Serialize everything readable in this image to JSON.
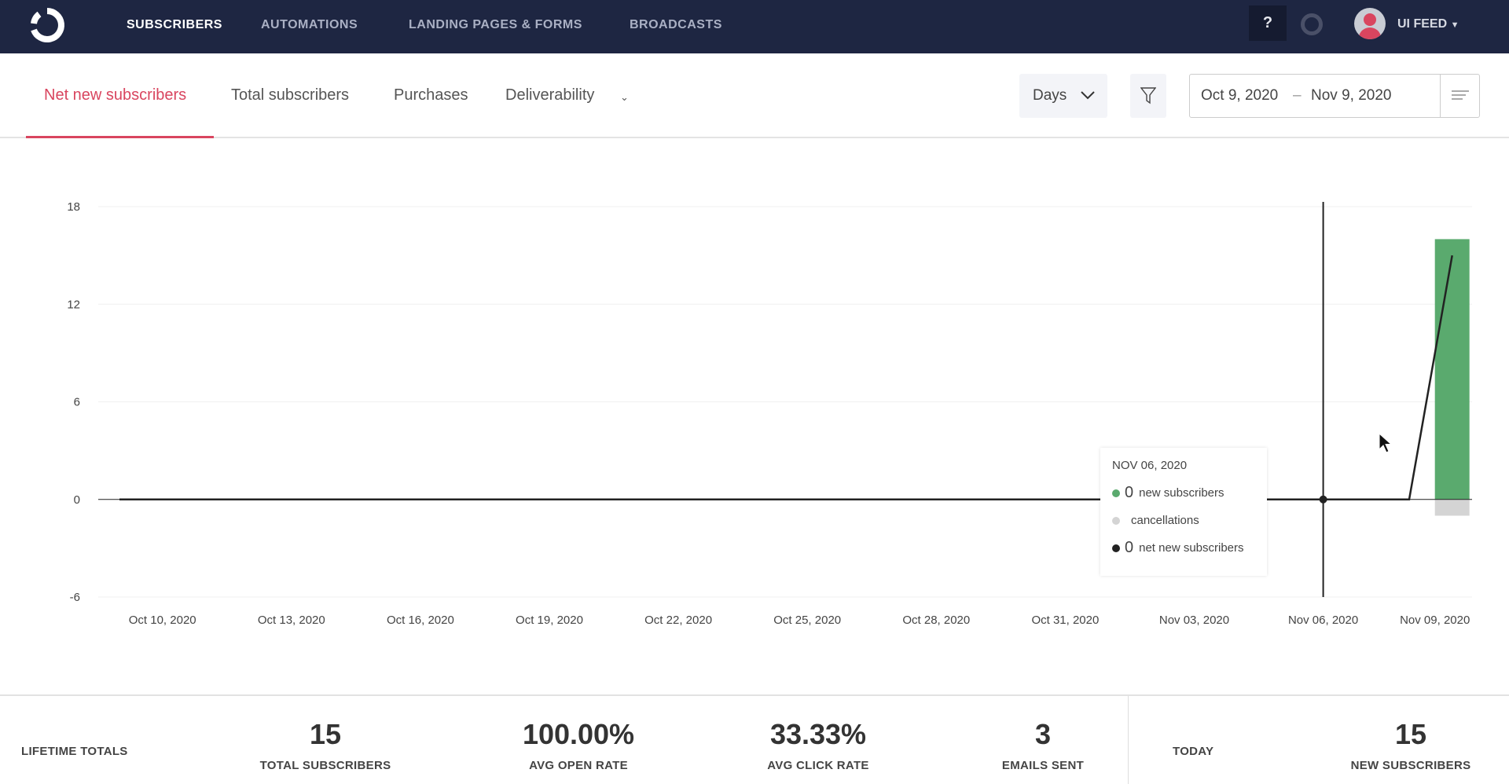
{
  "nav": {
    "items": [
      {
        "label": "SUBSCRIBERS",
        "active": true
      },
      {
        "label": "AUTOMATIONS"
      },
      {
        "label": "LANDING PAGES & FORMS"
      },
      {
        "label": "BROADCASTS"
      }
    ],
    "help_label": "?",
    "user_label": "UI FEED"
  },
  "tabs": [
    {
      "label": "Net new subscribers",
      "active": true
    },
    {
      "label": "Total subscribers"
    },
    {
      "label": "Purchases"
    },
    {
      "label": "Deliverability"
    }
  ],
  "controls": {
    "interval": "Days",
    "date_start": "Oct 9, 2020",
    "date_sep": "–",
    "date_end": "Nov 9, 2020"
  },
  "colors": {
    "nav_bg": "#1e2642",
    "accent": "#d9455f",
    "new_subscribers": "#5aaa6e",
    "cancellations": "#d4d4d4",
    "net": "#222222"
  },
  "chart_data": {
    "type": "bar",
    "ylim": [
      -6,
      18
    ],
    "yticks": [
      "18",
      "12",
      "6",
      "0",
      "-6"
    ],
    "grid": true,
    "xtick_labels": [
      "Oct 10, 2020",
      "Oct 13, 2020",
      "Oct 16, 2020",
      "Oct 19, 2020",
      "Oct 22, 2020",
      "Oct 25, 2020",
      "Oct 28, 2020",
      "Oct 31, 2020",
      "Nov 03, 2020",
      "Nov 06, 2020",
      "Nov 09, 2020"
    ],
    "x": [
      "Oct 9",
      "Oct 10",
      "Oct 11",
      "Oct 12",
      "Oct 13",
      "Oct 14",
      "Oct 15",
      "Oct 16",
      "Oct 17",
      "Oct 18",
      "Oct 19",
      "Oct 20",
      "Oct 21",
      "Oct 22",
      "Oct 23",
      "Oct 24",
      "Oct 25",
      "Oct 26",
      "Oct 27",
      "Oct 28",
      "Oct 29",
      "Oct 30",
      "Oct 31",
      "Nov 1",
      "Nov 2",
      "Nov 3",
      "Nov 4",
      "Nov 5",
      "Nov 6",
      "Nov 7",
      "Nov 8",
      "Nov 9"
    ],
    "series": [
      {
        "name": "new subscribers",
        "kind": "bar",
        "values": [
          0,
          0,
          0,
          0,
          0,
          0,
          0,
          0,
          0,
          0,
          0,
          0,
          0,
          0,
          0,
          0,
          0,
          0,
          0,
          0,
          0,
          0,
          0,
          0,
          0,
          0,
          0,
          0,
          0,
          0,
          0,
          16
        ]
      },
      {
        "name": "cancellations",
        "kind": "bar",
        "values": [
          0,
          0,
          0,
          0,
          0,
          0,
          0,
          0,
          0,
          0,
          0,
          0,
          0,
          0,
          0,
          0,
          0,
          0,
          0,
          0,
          0,
          0,
          0,
          0,
          0,
          0,
          0,
          0,
          0,
          0,
          0,
          -1
        ]
      },
      {
        "name": "net new subscribers",
        "kind": "line",
        "values": [
          0,
          0,
          0,
          0,
          0,
          0,
          0,
          0,
          0,
          0,
          0,
          0,
          0,
          0,
          0,
          0,
          0,
          0,
          0,
          0,
          0,
          0,
          0,
          0,
          0,
          0,
          0,
          0,
          0,
          0,
          0,
          15
        ]
      }
    ],
    "hover_index": 28
  },
  "tooltip": {
    "date": "NOV 06, 2020",
    "new_value": "0",
    "new_label": "new subscribers",
    "cancel_value": "",
    "cancel_label": "cancellations",
    "net_value": "0",
    "net_label": "net new subscribers"
  },
  "stats": {
    "lifetime_label": "LIFETIME TOTALS",
    "today_label": "TODAY",
    "items": [
      {
        "value": "15",
        "label": "TOTAL SUBSCRIBERS"
      },
      {
        "value": "100.00%",
        "label": "AVG OPEN RATE"
      },
      {
        "value": "33.33%",
        "label": "AVG CLICK RATE"
      },
      {
        "value": "3",
        "label": "EMAILS SENT"
      },
      {
        "value": "15",
        "label": "NEW SUBSCRIBERS"
      }
    ]
  }
}
